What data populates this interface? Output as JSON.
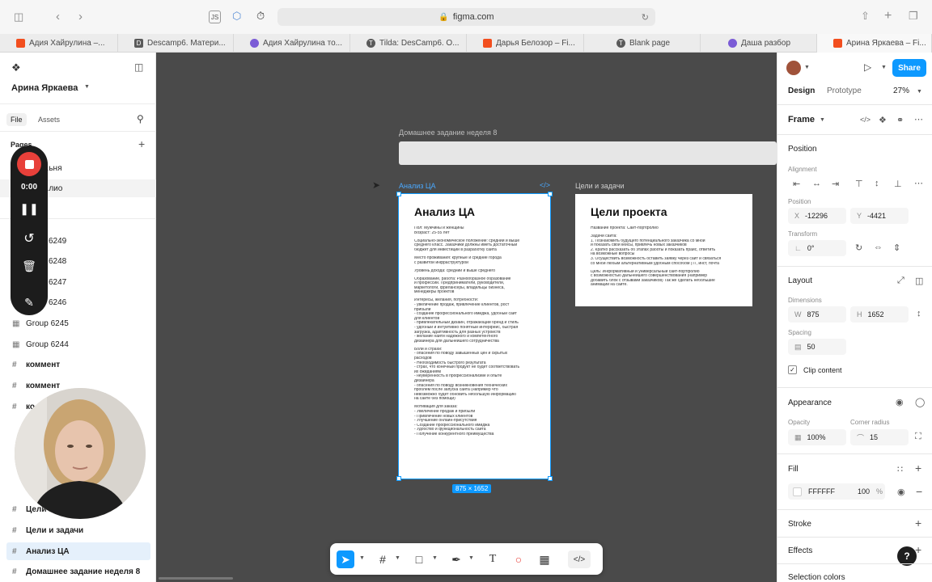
{
  "browser": {
    "url": "figma.com",
    "ext_js": "JS",
    "tabs": [
      {
        "label": "Адия Хайрулина –...",
        "icon": "figma-logo-icon",
        "color": "#f24e1e"
      },
      {
        "label": "Descamp6. Матери...",
        "icon": "d-logo-icon",
        "color": "#5a5a5a"
      },
      {
        "label": "Адия Хайрулина то...",
        "icon": "flower-logo-icon",
        "color": "#7b5cd6"
      },
      {
        "label": "Tilda: DesCamp6. О...",
        "icon": "tilda-logo-icon",
        "color": "#5a5a5a"
      },
      {
        "label": "Дарья Белозор – Fi...",
        "icon": "figma-logo-icon",
        "color": "#f24e1e"
      },
      {
        "label": "Blank page",
        "icon": "tilda-logo-icon",
        "color": "#5a5a5a"
      },
      {
        "label": "Даша разбор",
        "icon": "flower-logo-icon",
        "color": "#7b5cd6"
      },
      {
        "label": "Арина Яркаева – Fi...",
        "icon": "figma-logo-icon",
        "color": "#f24e1e"
      }
    ]
  },
  "left_panel": {
    "user_name": "Арина Яркаева",
    "tab_file": "File",
    "tab_assets": "Assets",
    "pages_label": "Pages",
    "pages": [
      "...ьня",
      "...лио"
    ],
    "layers": [
      {
        "label": "6249",
        "type": "group"
      },
      {
        "label": "6248",
        "type": "group"
      },
      {
        "label": "6247",
        "type": "group"
      },
      {
        "label": "6246",
        "type": "group"
      },
      {
        "label": "Group 6245",
        "type": "group"
      },
      {
        "label": "Group 6244",
        "type": "group"
      },
      {
        "label": "коммент",
        "type": "frame"
      },
      {
        "label": "коммент",
        "type": "frame"
      },
      {
        "label": "ко...",
        "type": "frame"
      }
    ],
    "layers_bottom": [
      {
        "label": "Цели и...",
        "type": "frame",
        "selected": false
      },
      {
        "label": "Цели и задачи",
        "type": "frame",
        "selected": false
      },
      {
        "label": "Анализ ЦА",
        "type": "frame",
        "selected": true
      },
      {
        "label": "Домашнее задание неделя 8",
        "type": "frame",
        "selected": false
      }
    ]
  },
  "recorder": {
    "time": "0:00"
  },
  "canvas": {
    "section_label": "Домашнее задание неделя 8",
    "frame1_label": "Анализ ЦА",
    "frame1_title": "Анализ ЦА",
    "frame2_label": "Цели и задачи",
    "frame2_title": "Цели проекта",
    "size_badge": "875 × 1652",
    "frame1_lines": [
      "Пол: Мужчины и женщины",
      "Возраст: 25-55 лет",
      "",
      "Социально-экономическое положение: средний и выше",
      "среднего класс. Заказчики должны иметь достаточный",
      "бюджет для инвестиций в разработку сайта",
      "",
      "Место проживания: крупные и средние города",
      "с развитой инфраструктурой",
      "",
      "Уровень дохода: средний и выше среднего",
      "",
      "Образование, работа: Разнообразное образование",
      "и профессии. Предприниматели, руководители,",
      "маркетологи, фрилансеры, владельцы бизнеса,",
      "менеджеры проектов",
      "",
      "Интересы, желания, потребности:",
      "- увеличение продаж, привлечение клиентов, рост",
      "прибыли",
      "- создание профессионального имиджа, удобный сайт",
      "для клиентов",
      "- привлекательный дизайн, отражающий бренд и стиль",
      "- удобный и интуитивно понятный интерфейс, быстрая",
      "загрузка, адаптивность для разных устройств",
      "- желание найти надежного и компетентного",
      "дизайнера для дальнейшего сотрудничества",
      "",
      "Боли и страхи:",
      "- опасения по поводу завышенных цен и скрытых",
      "расходов",
      "- Необходимость быстрого результата",
      "- страх, что конечный продукт не будет соответствовать",
      "их ожиданиям",
      "- неуверенность в профессионализме и опыте",
      "дизайнера",
      "- опасения по поводу возникновения технических",
      "проблем после запуска сайта (например что",
      "невозможно будет обновить небольшую информацию",
      "на сайте без помощи)",
      "",
      "Мотивация для заказа:",
      "- Увеличение продаж и прибыли",
      "- Привлечение новых клиентов",
      "- Улучшение онлайн-присутствия",
      "- Создание профессионального имиджа",
      "- Удобство и функциональность сайта",
      "- Получение конкурентного преимущества"
    ],
    "frame2_lines": [
      "Название проекта: Сайт-портфолио",
      "",
      "Задачи сайта:",
      "1. Познакомить будущего потенциального заказчика со мной",
      "и показать свои кейсы, привлечь новых заказчиков",
      "2. Кратко рассказать об этапах работы и показать прайс, ответить",
      "на возможные вопросы",
      "3. Осуществить возможность оставить заявку через сайт и связаться",
      "со мной любым альтернативным удобным способом (ТГ, инст, почта",
      "",
      "Цель: Информативный и универсальный сайт-портфолио",
      "с возможностью дальнейшего совершенствования (например",
      "добавить блок с отзывами заказчиков) Так же сделать небольшие",
      "анимации на сайте."
    ]
  },
  "right_panel": {
    "tab_design": "Design",
    "tab_prototype": "Prototype",
    "zoom": "27%",
    "share_label": "Share",
    "frame_label": "Frame",
    "position_head": "Position",
    "alignment_sub": "Alignment",
    "position_sub": "Position",
    "x_key": "X",
    "x_val": "-12296",
    "y_key": "Y",
    "y_val": "-4421",
    "transform_sub": "Transform",
    "rotation_val": "0°",
    "layout_head": "Layout",
    "dimensions_sub": "Dimensions",
    "w_key": "W",
    "w_val": "875",
    "h_key": "H",
    "h_val": "1652",
    "spacing_sub": "Spacing",
    "spacing_val": "50",
    "clip_label": "Clip content",
    "appearance_head": "Appearance",
    "opacity_sub": "Opacity",
    "opacity_val": "100%",
    "radius_sub": "Corner radius",
    "radius_val": "15",
    "fill_head": "Fill",
    "fill_hex": "FFFFFF",
    "fill_opacity": "100",
    "fill_pct": "%",
    "stroke_head": "Stroke",
    "effects_head": "Effects",
    "selection_colors_head": "Selection colors",
    "help": "?"
  },
  "colors": {
    "accent": "#0d99ff",
    "canvas": "#4a4a4a",
    "record": "#e8403a"
  }
}
